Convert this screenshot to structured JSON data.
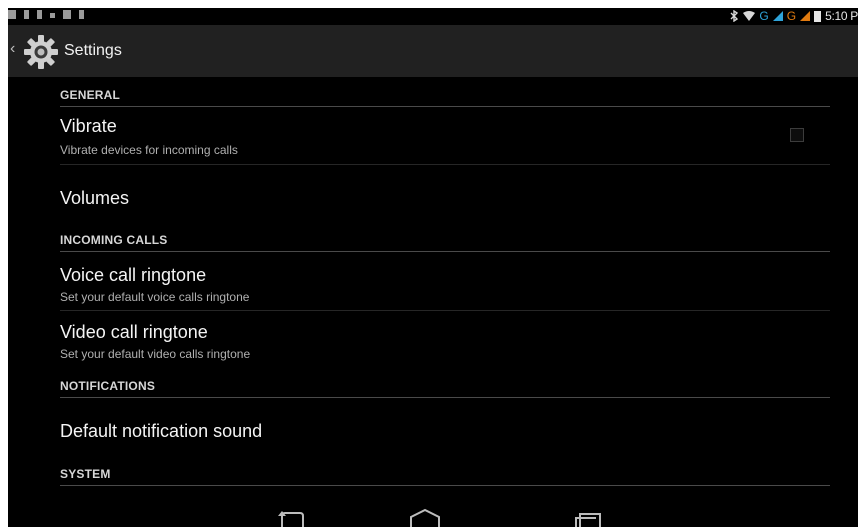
{
  "status_bar": {
    "network_label_1": "G",
    "network_label_2": "G",
    "time": "5:10 P"
  },
  "action_bar": {
    "title": "Settings"
  },
  "sections": {
    "general": "GENERAL",
    "incoming_calls": "INCOMING CALLS",
    "notifications": "NOTIFICATIONS",
    "system": "SYSTEM"
  },
  "prefs": {
    "vibrate": {
      "title": "Vibrate",
      "summary": "Vibrate devices for incoming calls",
      "checked": false
    },
    "volumes": {
      "title": "Volumes"
    },
    "voice_ringtone": {
      "title": "Voice call ringtone",
      "summary": "Set your default voice calls ringtone"
    },
    "video_ringtone": {
      "title": "Video call ringtone",
      "summary": "Set your default video calls ringtone"
    },
    "notification_sound": {
      "title": "Default notification sound"
    }
  },
  "icons": {
    "up": "chevron-left-icon",
    "settings": "gear-icon",
    "back": "back-icon",
    "home": "home-icon",
    "recents": "recents-icon"
  },
  "colors": {
    "background": "#000000",
    "action_bar": "#212121",
    "divider": "#4a4a4a",
    "network_blue": "#2ea3d9",
    "network_orange": "#e07a10"
  }
}
